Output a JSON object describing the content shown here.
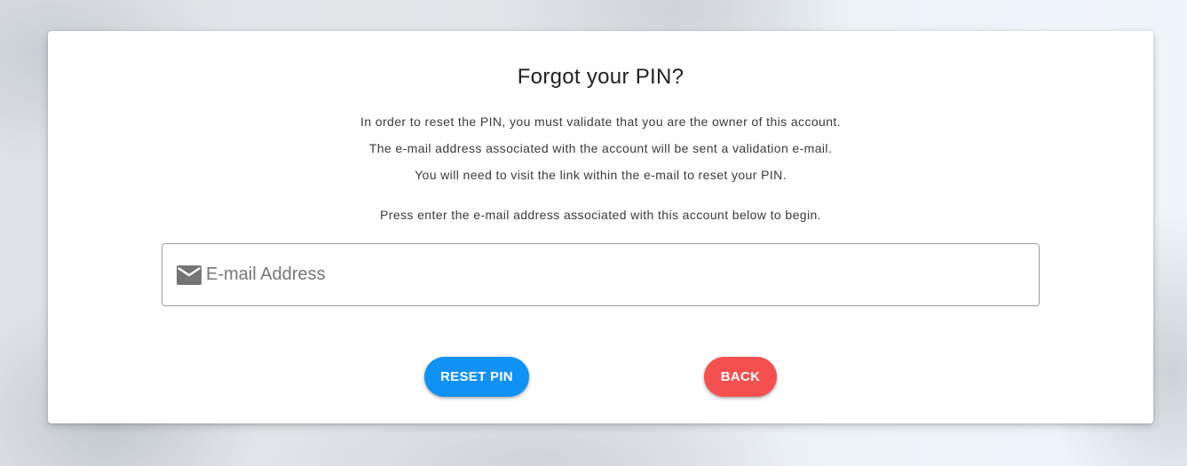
{
  "page": {
    "title": "Forgot your PIN?",
    "description_lines": [
      "In order to reset the PIN, you must validate that you are the owner of this account.",
      "The e-mail address associated with the account will be sent a validation e-mail.",
      "You will need to visit the link within the e-mail to reset your PIN."
    ],
    "instruction": "Press enter the e-mail address associated with this account below to begin."
  },
  "email_field": {
    "icon": "mail-icon",
    "placeholder": "E-mail Address",
    "value": ""
  },
  "buttons": {
    "reset_label": "RESET PIN",
    "back_label": "BACK"
  },
  "colors": {
    "reset_button": "#1091f4",
    "back_button": "#f45050",
    "icon": "#757575"
  }
}
